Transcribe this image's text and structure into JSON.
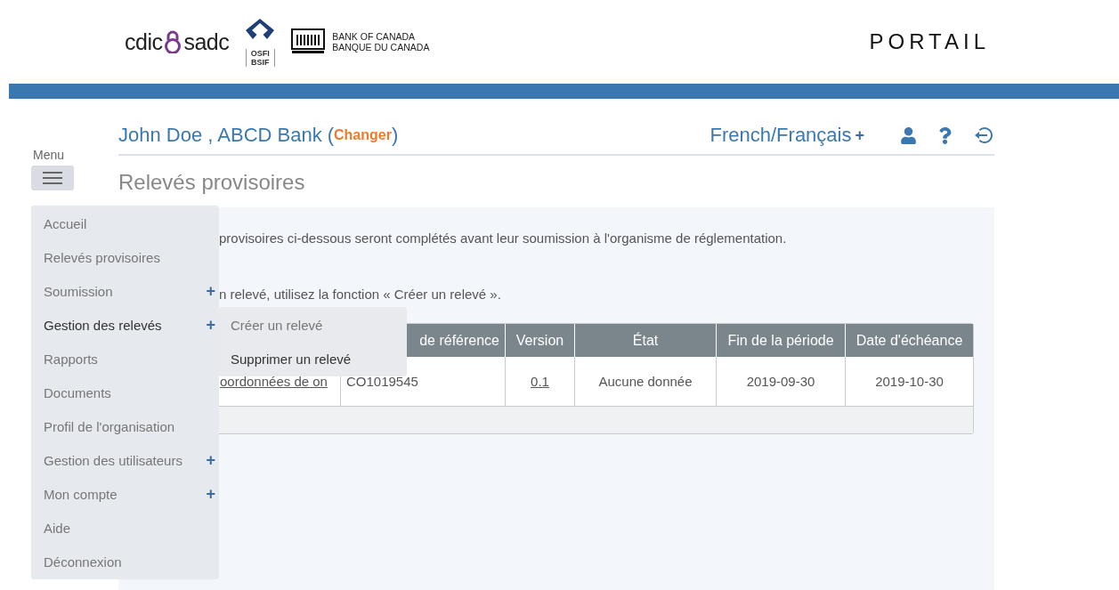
{
  "logos": {
    "cdic": "cdic",
    "sadc": "sadc",
    "osfi": "OSFI",
    "bsif": "BSIF",
    "boc_en": "BANK OF CANADA",
    "boc_fr": "BANQUE DU CANADA"
  },
  "portal_title": "PORTAIL",
  "user_line": {
    "name": "John Doe , ABCD Bank",
    "open_paren": "(",
    "change_link": "Changer",
    "close_paren": ")"
  },
  "language": {
    "label": "French/Français",
    "plus": "+"
  },
  "page_title": "Relevés provisoires",
  "menu": {
    "label": "Menu",
    "items": [
      {
        "label": "Accueil",
        "expanded": false
      },
      {
        "label": "Relevés provisoires",
        "expanded": false
      },
      {
        "label": "Soumission",
        "expanded": false,
        "plus": "+"
      },
      {
        "label": "Gestion des relevés",
        "expanded": true,
        "plus": "+",
        "submenu": [
          {
            "label": "Créer un relevé",
            "selected": false
          },
          {
            "label": "Supprimer un relevé",
            "selected": true
          }
        ]
      },
      {
        "label": "Rapports",
        "expanded": false
      },
      {
        "label": "Documents",
        "expanded": false
      },
      {
        "label": "Profil de l'organisation",
        "expanded": false
      },
      {
        "label": "Gestion des utilisateurs",
        "expanded": false,
        "plus": "+"
      },
      {
        "label": "Mon compte",
        "expanded": false,
        "plus": "+"
      },
      {
        "label": "Aide",
        "expanded": false
      },
      {
        "label": "Déconnexion",
        "expanded": false
      }
    ]
  },
  "intro": [
    "provisoires ci-dessous seront complétés avant leur soumission à l'organisme de réglementation.",
    "n relevé, utilisez la fonction « Créer un relevé »."
  ],
  "table": {
    "columns": [
      "",
      "de référence",
      "Version",
      "État",
      "Fin de la période",
      "Date d'échéance"
    ],
    "rows": [
      {
        "cells": [
          {
            "text": "oordonnées de on",
            "link": true
          },
          {
            "text": "CO1019545",
            "link": false
          },
          {
            "text": "0.1",
            "link": true
          },
          {
            "text": "Aucune donnée",
            "link": false
          },
          {
            "text": "2019-09-30",
            "link": false
          },
          {
            "text": "2019-10-30",
            "link": false
          }
        ]
      }
    ]
  }
}
